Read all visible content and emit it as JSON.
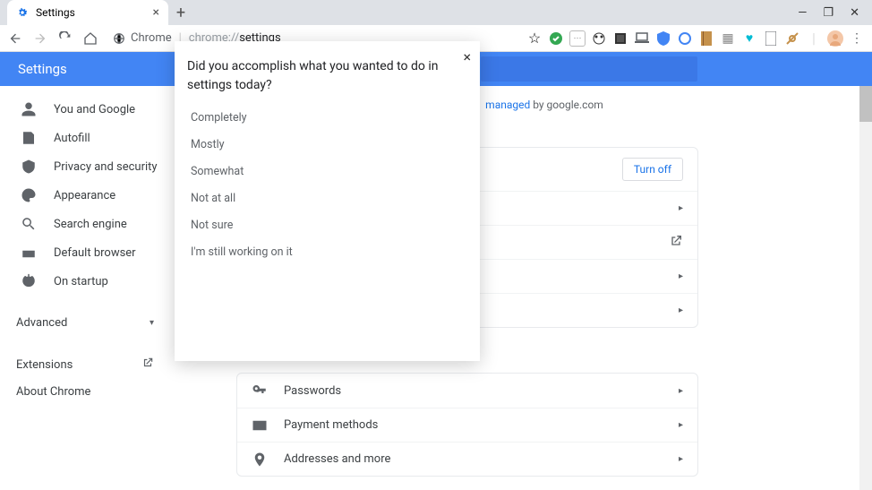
{
  "browser": {
    "tab_title": "Settings",
    "url_host": "Chrome",
    "url_path": "chrome://settings",
    "new_tab_tooltip": "+"
  },
  "win_controls": {
    "min": "—",
    "max": "❐",
    "close": "✕"
  },
  "omnibar_icons": [
    "star",
    "green-check",
    "vpn",
    "panda",
    "film",
    "laptop",
    "shield-blue",
    "circle-blue",
    "book",
    "grid",
    "heart",
    "doc",
    "strike"
  ],
  "header": {
    "title": "Settings"
  },
  "sidebar": {
    "items": [
      {
        "icon": "person",
        "label": "You and Google"
      },
      {
        "icon": "form",
        "label": "Autofill"
      },
      {
        "icon": "shield",
        "label": "Privacy and security"
      },
      {
        "icon": "palette",
        "label": "Appearance"
      },
      {
        "icon": "search",
        "label": "Search engine"
      },
      {
        "icon": "browser",
        "label": "Default browser"
      },
      {
        "icon": "power",
        "label": "On startup"
      }
    ],
    "advanced": "Advanced",
    "extensions": "Extensions",
    "about": "About Chrome"
  },
  "main": {
    "managed_prefix": "managed",
    "managed_by": " by google.com",
    "sync_card": {
      "turn_off": "Turn off",
      "rows": [
        "",
        "",
        "",
        "",
        ""
      ]
    },
    "autofill_card": {
      "rows": [
        {
          "icon": "key",
          "label": "Passwords"
        },
        {
          "icon": "card",
          "label": "Payment methods"
        },
        {
          "icon": "pin",
          "label": "Addresses and more"
        }
      ]
    }
  },
  "survey": {
    "question": "Did you accomplish what you wanted to do in settings today?",
    "options": [
      "Completely",
      "Mostly",
      "Somewhat",
      "Not at all",
      "Not sure",
      "I'm still working on it"
    ]
  }
}
